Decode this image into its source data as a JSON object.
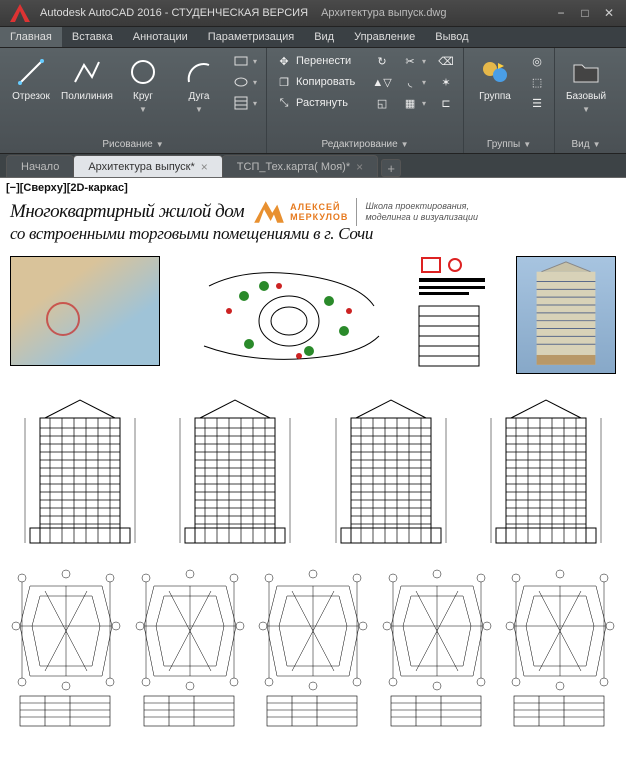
{
  "app": {
    "title": "Autodesk AutoCAD 2016 - СТУДЕНЧЕСКАЯ ВЕРСИЯ",
    "document": "Архитектура выпуск.dwg"
  },
  "menu": {
    "items": [
      "Главная",
      "Вставка",
      "Аннотации",
      "Параметризация",
      "Вид",
      "Управление",
      "Вывод"
    ],
    "active": 0
  },
  "ribbon": {
    "draw": {
      "label": "Рисование",
      "line": "Отрезок",
      "polyline": "Полилиния",
      "circle": "Круг",
      "arc": "Дуга"
    },
    "modify": {
      "label": "Редактирование",
      "move": "Перенести",
      "copy": "Копировать",
      "stretch": "Растянуть"
    },
    "groups": {
      "label": "Группы",
      "group": "Группа"
    },
    "view": {
      "label": "Вид",
      "base": "Базовый"
    }
  },
  "tabs": {
    "items": [
      {
        "label": "Начало",
        "closable": false
      },
      {
        "label": "Архитектура выпуск*",
        "closable": true
      },
      {
        "label": "ТСП_Тех.карта( Моя)*",
        "closable": true
      }
    ],
    "active": 1
  },
  "canvas": {
    "view_label": "[−][Сверху][2D-каркас]",
    "title": "Многоквартирный жилой дом",
    "subtitle": "со встроенными торговыми помещениями в г. Сочи",
    "logo_name_1": "АЛЕКСЕЙ",
    "logo_name_2": "МЕРКУЛОВ",
    "tagline": "Школа проектирования, моделинга и визуализации"
  }
}
